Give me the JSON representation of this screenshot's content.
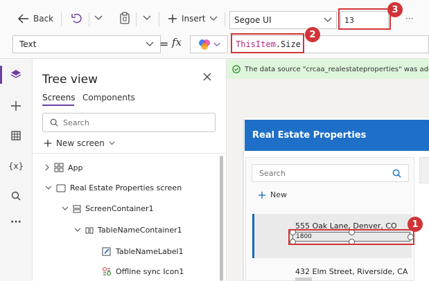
{
  "toolbar": {
    "back_label": "Back",
    "insert_label": "Insert",
    "font_value": "Segoe UI",
    "font_size_value": "13",
    "more_label": "···"
  },
  "formula_bar": {
    "property_value": "Text",
    "equals": "=",
    "fx": "fx",
    "formula_keyword": "ThisItem",
    "formula_rest": ".Size"
  },
  "badges": [
    "1",
    "2",
    "3"
  ],
  "colors": {
    "accent": "#0f6cbd",
    "red": "#d13438",
    "header_blue": "#1e6fc7"
  },
  "tree": {
    "title": "Tree view",
    "tabs": [
      "Screens",
      "Components"
    ],
    "search_placeholder": "Search",
    "new_screen_label": "New screen",
    "items": [
      {
        "label": "App",
        "icon": "app-icon"
      },
      {
        "label": "Real Estate Properties screen",
        "icon": "screen-icon"
      },
      {
        "label": "ScreenContainer1",
        "icon": "container-icon"
      },
      {
        "label": "TableNameContainer1",
        "icon": "columns-icon"
      },
      {
        "label": "TableNameLabel1",
        "icon": "label-icon"
      },
      {
        "label": "Offline sync Icon1",
        "icon": "sync-icon"
      }
    ]
  },
  "canvas": {
    "notice": "The data source \"crcaa_realestateproperties\" was added",
    "app_header": "Real Estate Properties",
    "search_placeholder": "Search",
    "new_label": "New",
    "list": [
      {
        "address": "555 Oak Lane, Denver, CO",
        "size": "1800"
      },
      {
        "address": "432 Elm Street, Riverside, CA"
      }
    ]
  }
}
